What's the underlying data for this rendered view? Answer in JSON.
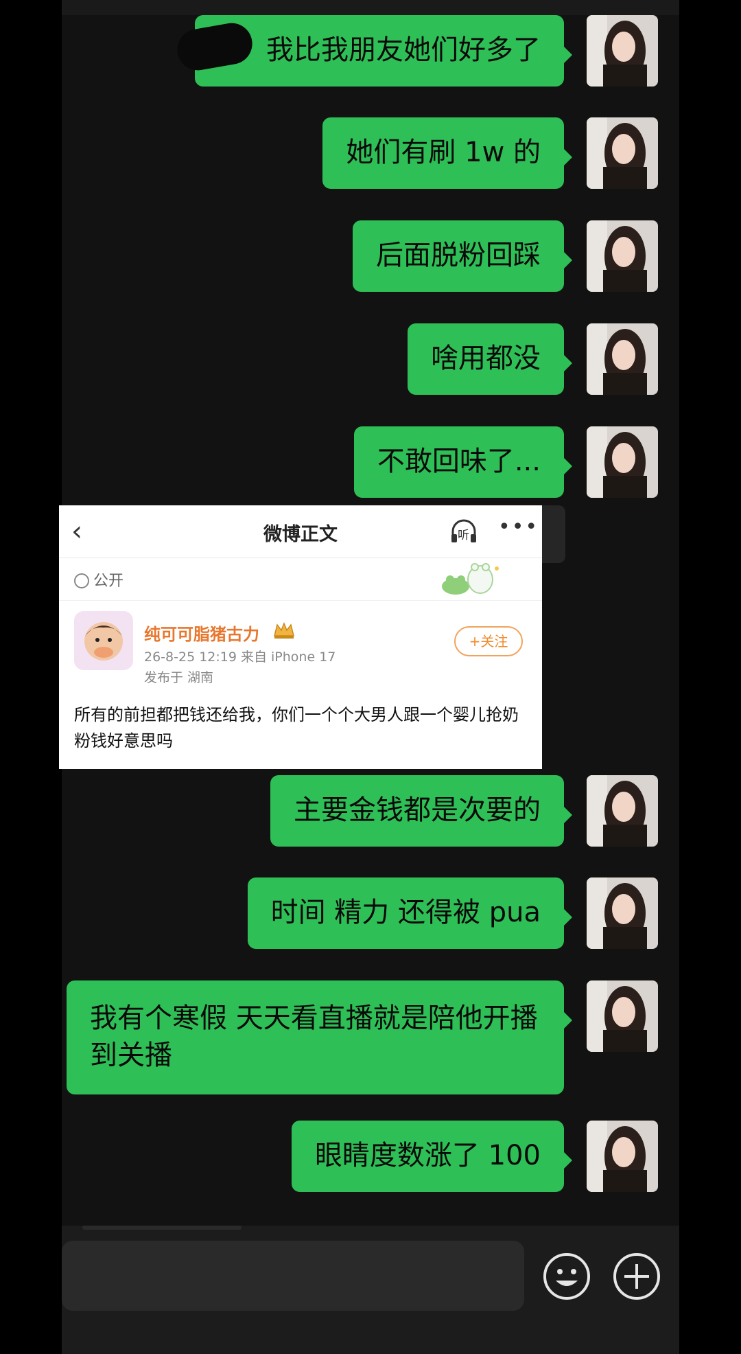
{
  "messages": [
    {
      "id": "m1",
      "text": "我比我朋友她们好多了",
      "censored": true
    },
    {
      "id": "m2",
      "text": "她们有刷 1w 的"
    },
    {
      "id": "m3",
      "text": "后面脱粉回踩"
    },
    {
      "id": "m4",
      "text": "啥用都没"
    },
    {
      "id": "m5",
      "text": "不敢回味了..."
    },
    {
      "id": "m6",
      "text": "主要金钱都是次要的"
    },
    {
      "id": "m7",
      "text": "时间 精力 还得被 pua"
    },
    {
      "id": "m8",
      "text": "我有个寒假 天天看直播就是陪他开播到关播"
    },
    {
      "id": "m9",
      "text": "眼睛度数涨了 100"
    }
  ],
  "weibo_card": {
    "back_icon": "chevron-left-icon",
    "title": "微博正文",
    "listen_label": "听",
    "more_icon": "ellipsis-icon",
    "visibility": "公开",
    "author": "纯可可脂猪古力",
    "time_source": "26-8-25 12:19  来自 iPhone 17",
    "location": "发布于 湖南",
    "follow_label": "+关注",
    "content": "所有的前担都把钱还给我，你们一个个大男人跟一个婴儿抢奶粉钱好意思吗"
  },
  "input_bar": {
    "emoji_icon": "emoji-icon",
    "plus_icon": "plus-icon"
  },
  "colors": {
    "bubble": "#2fbf57",
    "background": "#121212",
    "follow": "#f08c2e"
  }
}
